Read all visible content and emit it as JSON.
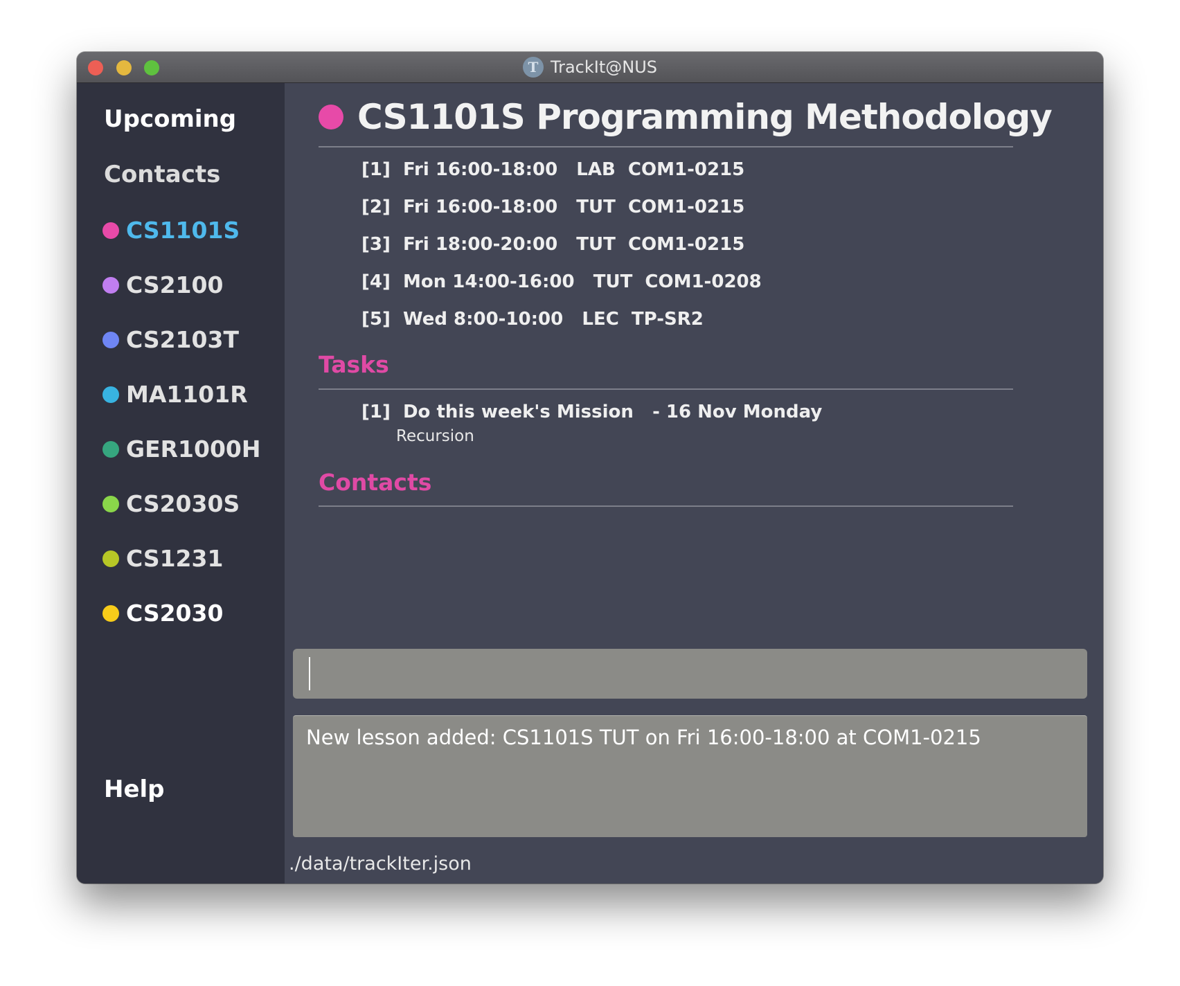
{
  "window": {
    "title": "TrackIt@NUS",
    "app_icon_letter": "T"
  },
  "sidebar": {
    "upcoming_label": "Upcoming",
    "contacts_label": "Contacts",
    "help_label": "Help",
    "modules": [
      {
        "code": "CS1101S",
        "color": "#e74aa8",
        "active": true
      },
      {
        "code": "CS2100",
        "color": "#c07ef0"
      },
      {
        "code": "CS2103T",
        "color": "#6f86f4"
      },
      {
        "code": "MA1101R",
        "color": "#38b3e1"
      },
      {
        "code": "GER1000H",
        "color": "#36a67f"
      },
      {
        "code": "CS2030S",
        "color": "#8ad64a"
      },
      {
        "code": "CS1231",
        "color": "#b7c726"
      },
      {
        "code": "CS2030",
        "color": "#f7cc1a"
      }
    ],
    "active_text_color": "#4fb9ec"
  },
  "module_view": {
    "title": "CS1101S Programming Methodology",
    "dot_color": "#e74aa8",
    "lessons": [
      "[1]  Fri 16:00-18:00   LAB  COM1-0215",
      "[2]  Fri 16:00-18:00   TUT  COM1-0215",
      "[3]  Fri 18:00-20:00   TUT  COM1-0215",
      "[4]  Mon 14:00-16:00   TUT  COM1-0208",
      "[5]  Wed 8:00-10:00   LEC  TP-SR2"
    ],
    "tasks_heading": "Tasks",
    "tasks": [
      {
        "line": "[1]  Do this week's Mission   - 16 Nov Monday",
        "description": "Recursion"
      }
    ],
    "contacts_heading": "Contacts"
  },
  "command_box": {
    "value": ""
  },
  "result_display": {
    "text": "New lesson added: CS1101S TUT on Fri 16:00-18:00 at COM1-0215"
  },
  "status_bar": {
    "path": "./data/trackIter.json"
  }
}
